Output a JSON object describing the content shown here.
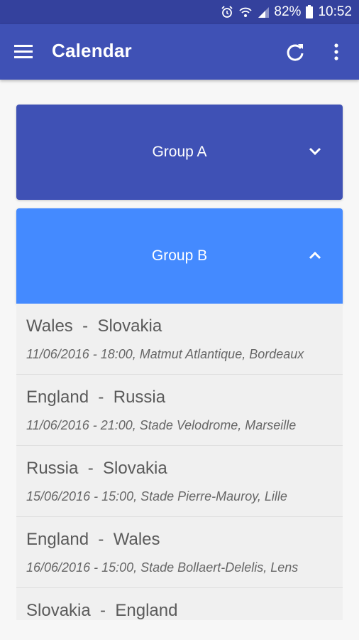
{
  "status_bar": {
    "battery": "82%",
    "time": "10:52",
    "icons": [
      "alarm-icon",
      "wifi-icon",
      "signal-icon",
      "battery-icon"
    ]
  },
  "app_bar": {
    "title": "Calendar",
    "icons": [
      "menu-icon",
      "refresh-icon",
      "more-vert-icon"
    ]
  },
  "groups": [
    {
      "label": "Group A",
      "expanded": false,
      "color": "#3f51b5"
    },
    {
      "label": "Group B",
      "expanded": true,
      "color": "#448aff"
    }
  ],
  "matches": [
    {
      "teams": "Wales  -  Slovakia",
      "details": "11/06/2016 - 18:00, Matmut Atlantique, Bordeaux"
    },
    {
      "teams": "England  -  Russia",
      "details": "11/06/2016 - 21:00, Stade Velodrome, Marseille"
    },
    {
      "teams": "Russia  -  Slovakia",
      "details": "15/06/2016 - 15:00, Stade Pierre-Mauroy, Lille"
    },
    {
      "teams": "England  -  Wales",
      "details": "16/06/2016 - 15:00, Stade Bollaert-Delelis, Lens"
    },
    {
      "teams": "Slovakia  -  England",
      "details": ""
    }
  ],
  "colors": {
    "status_bar": "#34419d",
    "app_bar": "#3f51b5",
    "list_bg": "#f0f0f0",
    "text": "#5a5a5a"
  }
}
